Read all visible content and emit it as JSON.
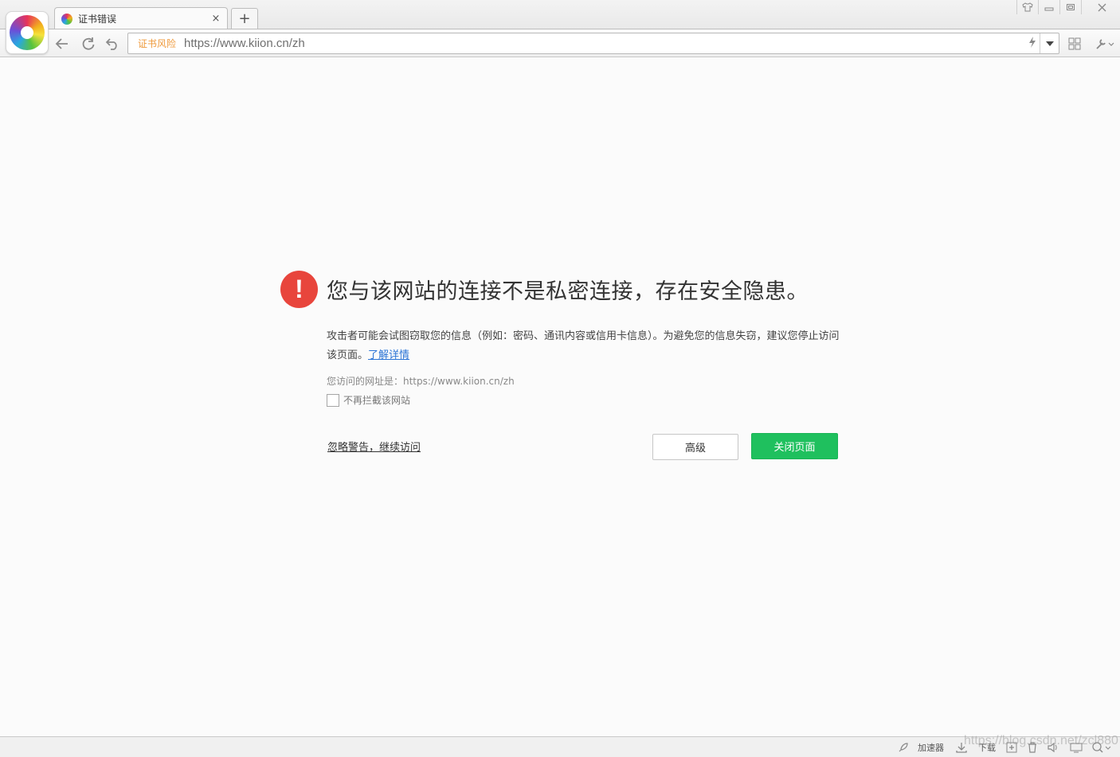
{
  "browser": {
    "tab": {
      "title": "证书错误",
      "close": "×",
      "new_tab": "+"
    },
    "window_controls": [
      "skin-icon",
      "minimize-icon",
      "maximize-icon",
      "close-icon"
    ],
    "address_bar": {
      "risk_label": "证书风险",
      "url": "https://www.kiion.cn/zh"
    }
  },
  "page": {
    "headline": "您与该网站的连接不是私密连接，存在安全隐患。",
    "description": "攻击者可能会试图窃取您的信息（例如：密码、通讯内容或信用卡信息）。为避免您的信息失窃，建议您停止访问该页面。",
    "learn_more": "了解详情",
    "visited_label": "您访问的网址是：https://www.kiion.cn/zh",
    "no_block_label": "不再拦截该网站",
    "ignore_link": "忽略警告，继续访问",
    "advanced_button": "高级",
    "close_button": "关闭页面"
  },
  "statusbar": {
    "accelerator": "加速器",
    "download": "下载",
    "watermark": "https://blog.csdn.net/zcl880"
  },
  "colors": {
    "warning_red": "#e8453c",
    "close_button_green": "#1fc05e",
    "link_blue": "#2b74d6",
    "risk_orange": "#ef9a3c"
  }
}
